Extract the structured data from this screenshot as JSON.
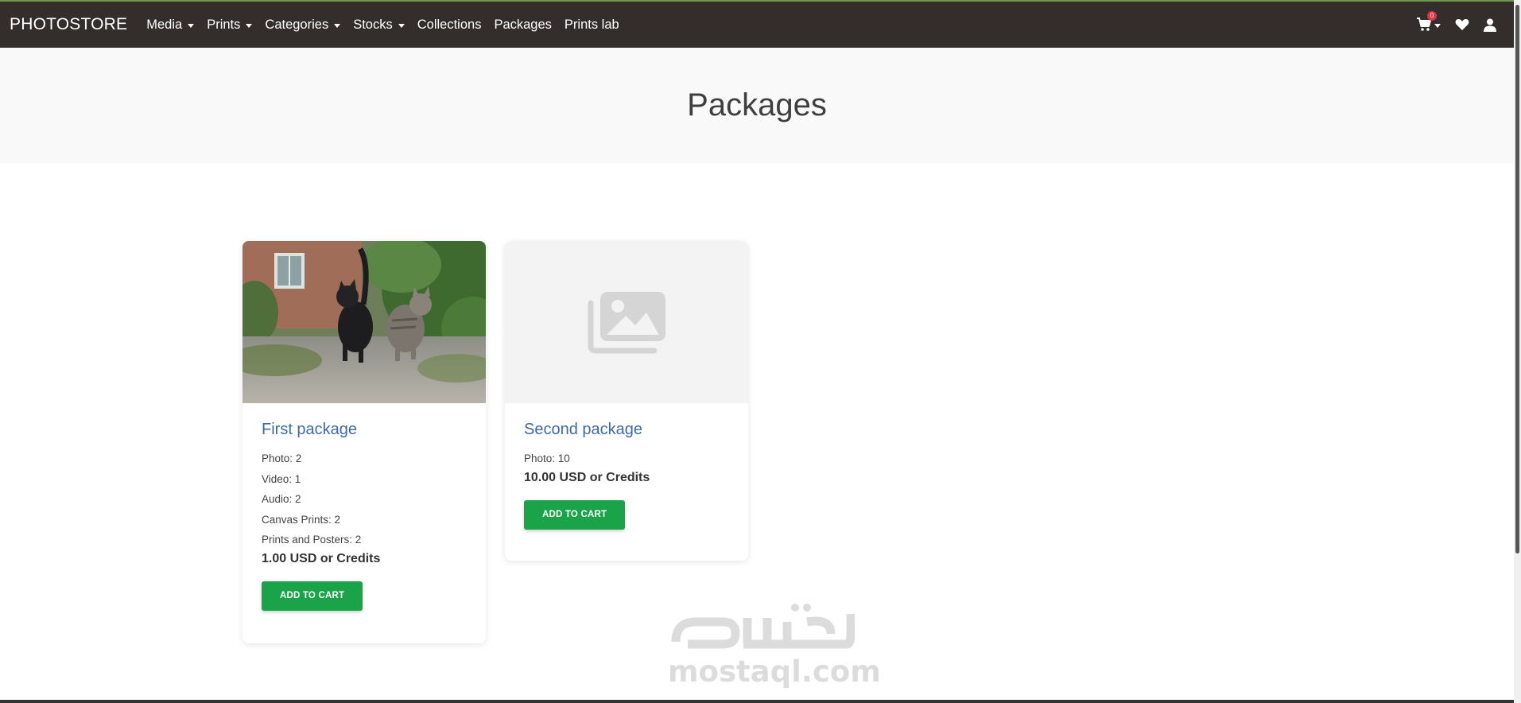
{
  "navbar": {
    "brand": "PHOTOSTORE",
    "items": [
      {
        "label": "Media",
        "dropdown": true
      },
      {
        "label": "Prints",
        "dropdown": true
      },
      {
        "label": "Categories",
        "dropdown": true
      },
      {
        "label": "Stocks",
        "dropdown": true
      },
      {
        "label": "Collections",
        "dropdown": false
      },
      {
        "label": "Packages",
        "dropdown": false
      },
      {
        "label": "Prints lab",
        "dropdown": false
      }
    ],
    "cart_count": "0",
    "icons": [
      "cart-icon",
      "heart-icon",
      "user-icon"
    ]
  },
  "header": {
    "title": "Packages"
  },
  "packages": [
    {
      "title": "First package",
      "features": [
        "Photo: 2",
        "Video: 1",
        "Audio: 2",
        "Canvas Prints: 2",
        "Prints and Posters: 2"
      ],
      "price": "1.00 USD or Credits",
      "button": "ADD TO CART",
      "image": "cats-photo"
    },
    {
      "title": "Second package",
      "features": [
        "Photo: 10"
      ],
      "price": "10.00 USD or Credits",
      "button": "ADD TO CART",
      "image": "placeholder-image-icon"
    }
  ],
  "watermark": {
    "text": "mostaql.com"
  },
  "colors": {
    "navbar": "#332e2c",
    "accent_green": "#1ba34a",
    "title_blue": "#3d6aa3",
    "badge_red": "#dc3545"
  }
}
